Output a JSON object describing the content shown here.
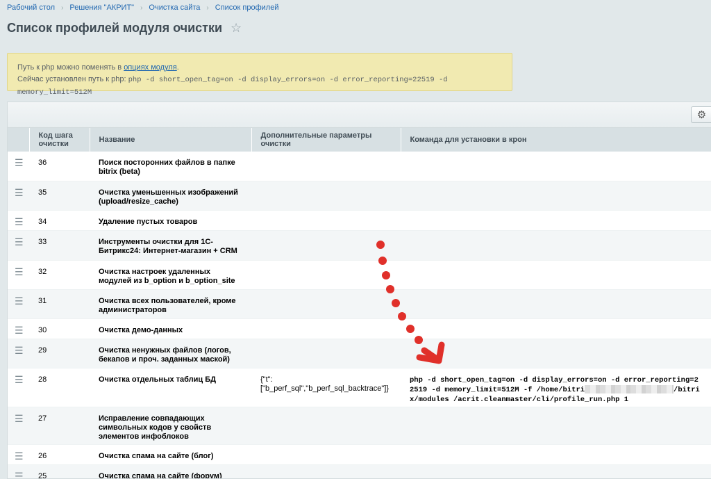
{
  "breadcrumbs": [
    "Рабочий стол",
    "Решения \"АКРИТ\"",
    "Очистка сайта",
    "Список профилей"
  ],
  "page_title": "Список профилей модуля очистки",
  "notice": {
    "line1_prefix": "Путь к php можно поменять в ",
    "line1_link": "опциях модуля",
    "line1_suffix": ".",
    "line2_prefix": "Сейчас установлен путь к php: ",
    "line2_value": "php -d short_open_tag=on -d display_errors=on -d error_reporting=22519 -d memory_limit=512M"
  },
  "columns": {
    "step": "Код шага очистки",
    "name": "Название",
    "params": "Дополнительные параметры очистки",
    "cron": "Команда для установки в крон"
  },
  "rows": [
    {
      "step": "36",
      "name": "Поиск посторонних файлов в папке bitrix (beta)",
      "params": "",
      "cron": ""
    },
    {
      "step": "35",
      "name": "Очистка уменьшенных изображений (upload/resize_cache)",
      "params": "",
      "cron": ""
    },
    {
      "step": "34",
      "name": "Удаление пустых товаров",
      "params": "",
      "cron": ""
    },
    {
      "step": "33",
      "name": "Инструменты очистки для 1С-Битрикс24: Интернет-магазин + CRM",
      "params": "",
      "cron": ""
    },
    {
      "step": "32",
      "name": "Очистка настроек удаленных модулей из b_option и b_option_site",
      "params": "",
      "cron": ""
    },
    {
      "step": "31",
      "name": "Очистка всех пользователей, кроме администраторов",
      "params": "",
      "cron": ""
    },
    {
      "step": "30",
      "name": "Очистка демо-данных",
      "params": "",
      "cron": ""
    },
    {
      "step": "29",
      "name": "Очистка ненужных файлов (логов, бекапов и проч. заданных маской)",
      "params": "",
      "cron": ""
    },
    {
      "step": "28",
      "name": "Очистка отдельных таблиц БД",
      "params": "{\"t\":[\"b_perf_sql\",\"b_perf_sql_backtrace\"]}",
      "cron_part1": "php -d short_open_tag=on -d display_errors=on -d error_reporting=22519 -d memory_limit=512M -f /home/bitri",
      "cron_part2": "/bitrix/modules /acrit.cleanmaster/cli/profile_run.php 1"
    },
    {
      "step": "27",
      "name": "Исправление совпадающих символьных кодов у свойств элементов инфоблоков",
      "params": "",
      "cron": ""
    },
    {
      "step": "26",
      "name": "Очистка спама на сайте (блог)",
      "params": "",
      "cron": ""
    },
    {
      "step": "25",
      "name": "Очистка спама на сайте (форум)",
      "params": "",
      "cron": ""
    }
  ],
  "icons": {
    "drag": "hamburger-icon",
    "settings": "gear-icon",
    "favorite": "star-icon"
  },
  "colors": {
    "annotation": "#e0302a",
    "link": "#2067b0",
    "notice_bg": "#f1eab1"
  }
}
